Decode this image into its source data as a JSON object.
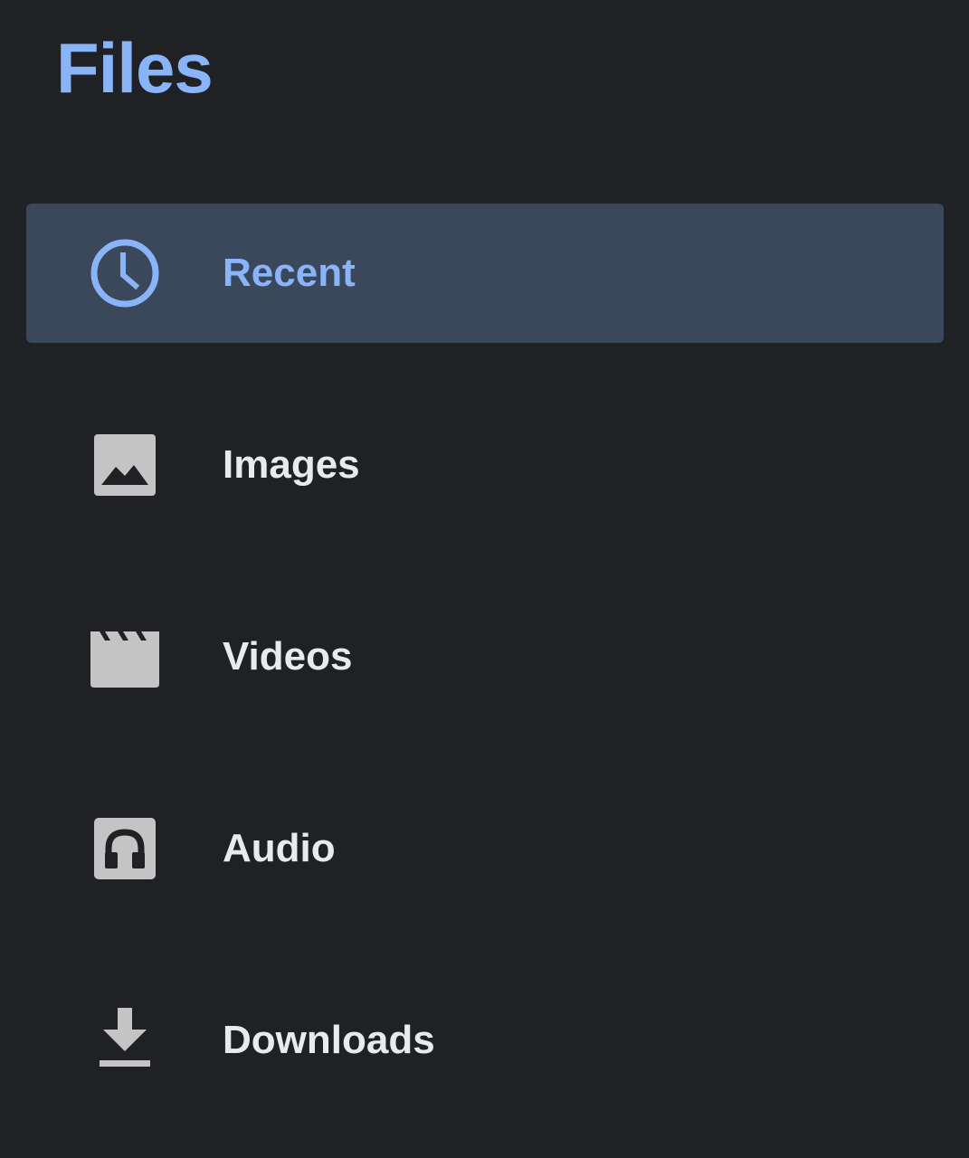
{
  "app": {
    "title": "Files"
  },
  "colors": {
    "background": "#202124",
    "accent": "#8ab4f8",
    "active_bg": "#3b475b",
    "text": "#e8eaed",
    "icon": "#c4c4c4"
  },
  "nav": {
    "items": [
      {
        "label": "Recent",
        "icon": "clock-icon",
        "active": true
      },
      {
        "label": "Images",
        "icon": "image-icon",
        "active": false
      },
      {
        "label": "Videos",
        "icon": "clapperboard-icon",
        "active": false
      },
      {
        "label": "Audio",
        "icon": "headphones-icon",
        "active": false
      },
      {
        "label": "Downloads",
        "icon": "download-icon",
        "active": false
      }
    ]
  }
}
